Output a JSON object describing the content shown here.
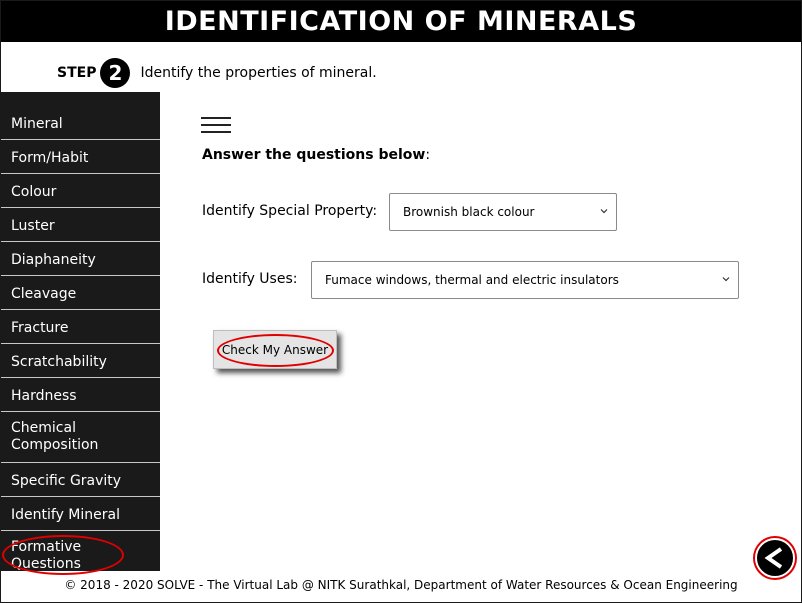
{
  "header": {
    "title": "IDENTIFICATION OF MINERALS"
  },
  "step": {
    "word": "STEP",
    "number": "2",
    "text": "Identify the properties of mineral."
  },
  "sidebar": {
    "items": [
      {
        "label": "Mineral"
      },
      {
        "label": "Form/Habit"
      },
      {
        "label": "Colour"
      },
      {
        "label": "Luster"
      },
      {
        "label": "Diaphaneity"
      },
      {
        "label": "Cleavage"
      },
      {
        "label": "Fracture"
      },
      {
        "label": "Scratchability"
      },
      {
        "label": "Hardness"
      },
      {
        "label": "Chemical Composition"
      },
      {
        "label": "Specific Gravity"
      },
      {
        "label": "Identify Mineral"
      },
      {
        "label": "Formative Questions"
      }
    ]
  },
  "main": {
    "menu_icon": "hamburger-icon",
    "instruction_bold": "Answer the questions below",
    "instruction_suffix": ":",
    "q1": {
      "label": "Identify Special Property:",
      "selected": "Brownish black colour"
    },
    "q2": {
      "label": "Identify Uses:",
      "selected": "Fumace windows, thermal and electric insulators"
    },
    "check_button": "Check My Answer"
  },
  "footer": {
    "text": "© 2018 - 2020 SOLVE - The Virtual Lab @ NITK Surathkal, Department of Water Resources & Ocean Engineering"
  },
  "back_icon": "chevron-left-icon",
  "colors": {
    "highlight_red": "#e00000",
    "sidebar_bg": "#1a1a1a",
    "header_bg": "#000000"
  }
}
